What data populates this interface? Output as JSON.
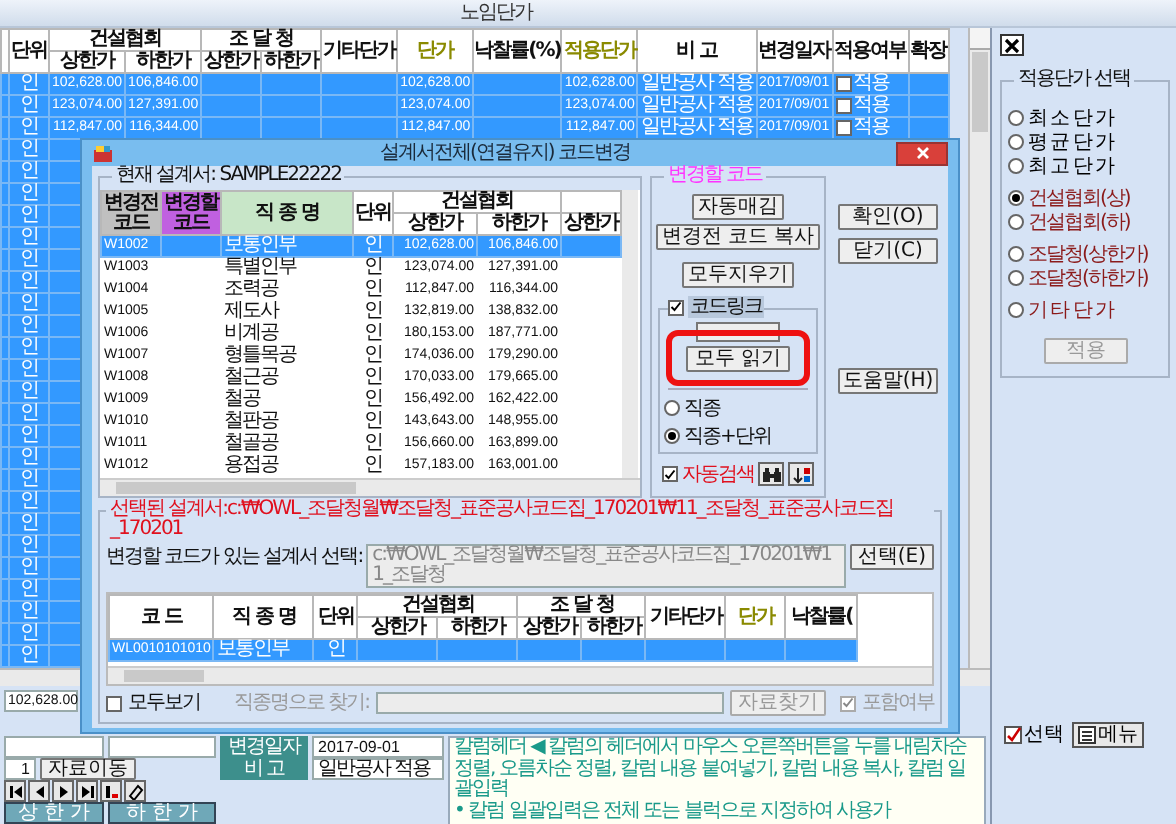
{
  "window": {
    "title": "노임단가"
  },
  "table": {
    "columns": [
      {
        "label": "단위"
      },
      {
        "group": "건설협회",
        "sub": [
          "상한가",
          "하한가"
        ]
      },
      {
        "group": "조 달 청",
        "sub": [
          "상한가",
          "하한가"
        ]
      },
      {
        "label": "기타단가"
      },
      {
        "label": "단가",
        "highlight": true
      },
      {
        "label": "낙찰률(%)"
      },
      {
        "label": "적용단가",
        "highlight": true
      },
      {
        "label": "비 고"
      },
      {
        "label": "변경일자"
      },
      {
        "label": "적용여부"
      },
      {
        "label": "확장"
      }
    ],
    "rows": [
      {
        "selected": true,
        "unit": "인",
        "kc_upper": "102,628.00",
        "kc_lower": "106,846.00",
        "price": "102,628.00",
        "applied_price": "102,628.00",
        "note": "일반공사 적용",
        "changed": "2017/09/01",
        "apply": {
          "label": "적용",
          "checked": false
        }
      },
      {
        "selected": true,
        "unit": "인",
        "kc_upper": "123,074.00",
        "kc_lower": "127,391.00",
        "price": "123,074.00",
        "applied_price": "123,074.00",
        "note": "일반공사 적용",
        "changed": "2017/09/01",
        "apply": {
          "label": "적용",
          "checked": false
        }
      },
      {
        "selected": true,
        "unit": "인",
        "kc_upper": "112,847.00",
        "kc_lower": "116,344.00",
        "price": "112,847.00",
        "applied_price": "112,847.00",
        "note": "일반공사 적용",
        "changed": "2017/09/01",
        "apply": {
          "label": "적용",
          "checked": false
        }
      },
      {
        "selected": true,
        "unit": "인"
      },
      {
        "selected": true,
        "unit": "인"
      },
      {
        "selected": true,
        "unit": "인"
      },
      {
        "selected": true,
        "unit": "인"
      },
      {
        "selected": true,
        "unit": "인"
      },
      {
        "selected": true,
        "unit": "인"
      },
      {
        "selected": true,
        "unit": "인"
      },
      {
        "selected": true,
        "unit": "인"
      },
      {
        "selected": true,
        "unit": "인"
      },
      {
        "selected": true,
        "unit": "인"
      },
      {
        "selected": true,
        "unit": "인"
      },
      {
        "selected": true,
        "unit": "인"
      },
      {
        "selected": true,
        "unit": "인"
      },
      {
        "selected": true,
        "unit": "인"
      },
      {
        "selected": true,
        "unit": "인"
      },
      {
        "selected": true,
        "unit": "인"
      },
      {
        "selected": true,
        "unit": "인"
      },
      {
        "selected": true,
        "unit": "인"
      },
      {
        "selected": true,
        "unit": "인"
      },
      {
        "selected": true,
        "unit": "인"
      },
      {
        "selected": true,
        "unit": "인"
      },
      {
        "selected": true,
        "unit": "인"
      },
      {
        "selected": true,
        "unit": "인"
      },
      {
        "selected": true,
        "unit": "인"
      }
    ]
  },
  "detail": {
    "upper_value": "102,628.00",
    "buttons": [
      "상 한 가",
      "하 한 가"
    ],
    "changed": {
      "label": "변경일자",
      "value": "2017-09-01"
    },
    "note": {
      "label": "비 고",
      "value": "일반공사 적용"
    },
    "page": "1",
    "move_button": "자료이동",
    "help": [
      "칼럼헤더 ◀ 칼럼의 헤더에서 마우스 오른쪽버튼을 누를 내림차순 정렬, 오름차순 정렬, 칼럼 내용 붙여넣기, 칼럼 내용 복사, 칼럼 일괄입력",
      "• 칼럼 일괄입력은 전체 또는 블럭으로 지정하여 사용가"
    ]
  },
  "price_select": {
    "title": "적용단가 선택",
    "option_groups": [
      [
        {
          "label": "최 소 단 가",
          "selected": false,
          "color": "#000000"
        },
        {
          "label": "평 균 단 가",
          "selected": false,
          "color": "#000000"
        },
        {
          "label": "최 고 단 가",
          "selected": false,
          "color": "#000000"
        }
      ],
      [
        {
          "label": "건설협회(상)",
          "selected": true,
          "color": "#8b1a1a"
        },
        {
          "label": "건설협회(하)",
          "selected": false,
          "color": "#8b1a1a"
        }
      ],
      [
        {
          "label": "조달청(상한가)",
          "selected": false,
          "color": "#8b1a1a"
        },
        {
          "label": "조달청(하한가)",
          "selected": false,
          "color": "#8b1a1a"
        }
      ],
      [
        {
          "label": "기 타 단 가",
          "selected": false,
          "color": "#8b1a1a"
        }
      ]
    ],
    "apply_button": "적용"
  },
  "footer": {
    "select": "선택",
    "menu": "메뉴"
  },
  "dialog": {
    "title": "설계서전체(연결유지) 코드변경",
    "current_label": "현재 설계서: SAMPLE22222",
    "code_table": {
      "columns": [
        {
          "label": "변경전 코드",
          "color": "#c0c0c0"
        },
        {
          "label": "변경할 코드",
          "color": "#c060e0"
        },
        {
          "label": "직 종 명",
          "color": "#c8e6c8"
        },
        {
          "label": "단위"
        },
        {
          "group": "건설협회",
          "sub": [
            "상한가",
            "하한가"
          ]
        },
        {
          "sub": [
            "상한가"
          ]
        }
      ],
      "rows": [
        {
          "from": "W1002",
          "name": "보통인부",
          "unit": "인",
          "upper": "102,628.00",
          "lower": "106,846.00",
          "selected": true
        },
        {
          "from": "W1003",
          "name": "특별인부",
          "unit": "인",
          "upper": "123,074.00",
          "lower": "127,391.00",
          "selected": false
        },
        {
          "from": "W1004",
          "name": "조력공",
          "unit": "인",
          "upper": "112,847.00",
          "lower": "116,344.00",
          "selected": false
        },
        {
          "from": "W1005",
          "name": "제도사",
          "unit": "인",
          "upper": "132,819.00",
          "lower": "138,832.00",
          "selected": false
        },
        {
          "from": "W1006",
          "name": "비계공",
          "unit": "인",
          "upper": "180,153.00",
          "lower": "187,771.00",
          "selected": false
        },
        {
          "from": "W1007",
          "name": "형틀목공",
          "unit": "인",
          "upper": "174,036.00",
          "lower": "179,290.00",
          "selected": false
        },
        {
          "from": "W1008",
          "name": "철근공",
          "unit": "인",
          "upper": "170,033.00",
          "lower": "179,665.00",
          "selected": false
        },
        {
          "from": "W1009",
          "name": "철공",
          "unit": "인",
          "upper": "156,492.00",
          "lower": "162,422.00",
          "selected": false
        },
        {
          "from": "W1010",
          "name": "철판공",
          "unit": "인",
          "upper": "143,643.00",
          "lower": "148,955.00",
          "selected": false
        },
        {
          "from": "W1011",
          "name": "철골공",
          "unit": "인",
          "upper": "156,660.00",
          "lower": "163,899.00",
          "selected": false
        },
        {
          "from": "W1012",
          "name": "용접공",
          "unit": "인",
          "upper": "157,183.00",
          "lower": "163,001.00",
          "selected": false
        }
      ]
    },
    "change_group": {
      "title": "변경할 코드",
      "buttons": [
        "자동매김",
        "변경전 코드 복사",
        "모두지우기"
      ],
      "link": {
        "label": "코드링크",
        "checked": true
      },
      "read_all": "모두 읽기",
      "match": [
        {
          "label": "직종",
          "selected": false
        },
        {
          "label": "직종+단위",
          "selected": true
        }
      ],
      "auto_search": {
        "label": "자동검색",
        "checked": true
      }
    },
    "side_buttons": [
      "확인(O)",
      "닫기(C)",
      "도움말(H)"
    ],
    "selected_file": "선택된 설계서:c:₩OWL_조달청월₩조달청_표준공사코드집_170201₩11_조달청_표준공사코드집_170201",
    "source_label": "변경할 코드가 있는 설계서 선택:",
    "source_value": "c:₩OWL_조달청월₩조달청_표준공사코드집_170201₩11_조달청",
    "select_button": "선택(E)",
    "source_table": {
      "columns": [
        {
          "label": "코 드"
        },
        {
          "label": "직 종 명"
        },
        {
          "label": "단위"
        },
        {
          "group": "건설협회",
          "sub": [
            "상한가",
            "하한가"
          ]
        },
        {
          "group": "조 달 청",
          "sub": [
            "상한가",
            "하한가"
          ]
        },
        {
          "label": "기타단가"
        },
        {
          "label": "단가",
          "highlight": true
        },
        {
          "label": "낙찰률("
        }
      ],
      "rows": [
        {
          "code": "WL0010101010",
          "name": "보통인부",
          "unit": "인",
          "selected": true
        }
      ]
    },
    "show_all": {
      "label": "모두보기",
      "checked": false
    },
    "find_label": "직종명으로 찾기:",
    "find_button": "자료찾기",
    "include": {
      "label": "포함여부",
      "checked": true
    }
  }
}
